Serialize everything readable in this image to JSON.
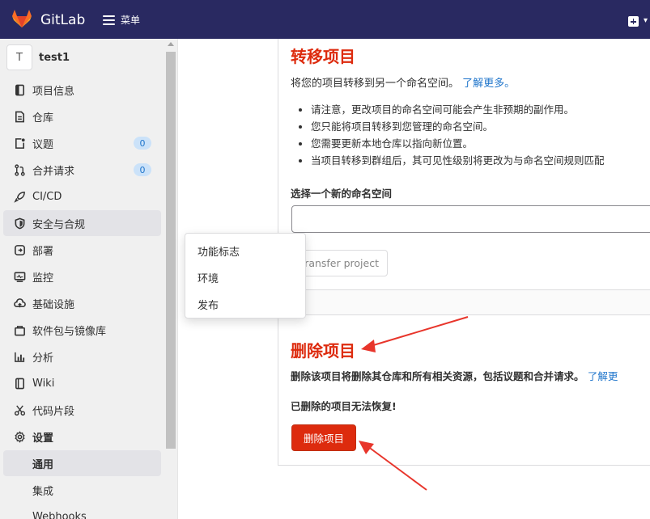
{
  "topbar": {
    "brand": "GitLab",
    "menu_label": "菜单",
    "brand_color": "#292961"
  },
  "sidebar": {
    "project_avatar": "T",
    "project_name": "test1",
    "items": [
      {
        "label": "项目信息",
        "icon": "project-info-icon"
      },
      {
        "label": "仓库",
        "icon": "repository-icon"
      },
      {
        "label": "议题",
        "icon": "issues-icon",
        "badge": "0"
      },
      {
        "label": "合并请求",
        "icon": "merge-request-icon",
        "badge": "0"
      },
      {
        "label": "CI/CD",
        "icon": "rocket-icon"
      },
      {
        "label": "安全与合规",
        "icon": "shield-icon"
      },
      {
        "label": "部署",
        "icon": "deploy-icon"
      },
      {
        "label": "监控",
        "icon": "monitor-icon"
      },
      {
        "label": "基础设施",
        "icon": "cloud-icon"
      },
      {
        "label": "软件包与镜像库",
        "icon": "package-icon"
      },
      {
        "label": "分析",
        "icon": "chart-icon"
      },
      {
        "label": "Wiki",
        "icon": "book-icon"
      },
      {
        "label": "代码片段",
        "icon": "scissors-icon"
      },
      {
        "label": "设置",
        "icon": "gear-icon"
      }
    ],
    "subitems": [
      "通用",
      "集成",
      "Webhooks"
    ]
  },
  "flyout": {
    "items": [
      "功能标志",
      "环境",
      "发布"
    ]
  },
  "transfer": {
    "title": "转移项目",
    "intro": "将您的项目转移到另一个命名空间。",
    "learn_more": "了解更多。",
    "bullets": [
      "请注意，更改项目的命名空间可能会产生非预期的副作用。",
      "您只能将项目转移到您管理的命名空间。",
      "您需要更新本地仓库以指向新位置。",
      "当项目转移到群组后，其可见性级别将更改为与命名空间规则匹配"
    ],
    "namespace_label": "选择一个新的命名空间",
    "namespace_value": "",
    "button": "Transfer project"
  },
  "delete": {
    "title": "删除项目",
    "desc": "删除该项目将删除其仓库和所有相关资源，包括议题和合并请求。",
    "learn_more": "了解更",
    "warning": "已删除的项目无法恢复!",
    "button": "删除项目",
    "danger_color": "#dd2b0e"
  },
  "annotation_color": "#e8352b"
}
